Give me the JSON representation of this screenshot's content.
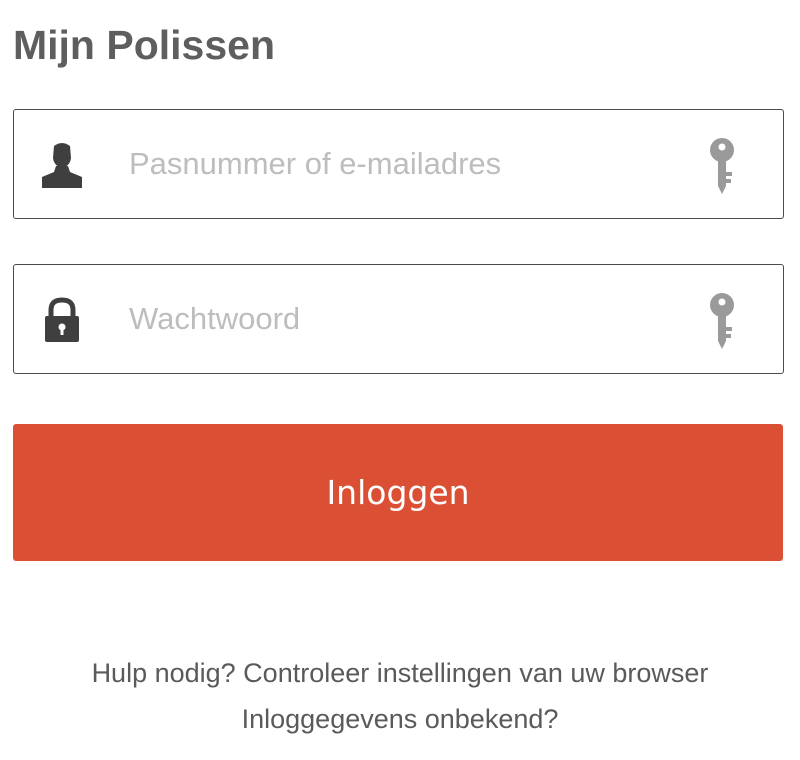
{
  "header": {
    "title": "Mijn Polissen"
  },
  "form": {
    "username": {
      "placeholder": "Pasnummer of e-mailadres",
      "value": "",
      "icon": "user-icon",
      "action_icon": "key-icon"
    },
    "password": {
      "placeholder": "Wachtwoord",
      "value": "",
      "icon": "lock-icon",
      "action_icon": "key-icon"
    },
    "submit_label": "Inloggen"
  },
  "links": {
    "help": "Hulp nodig? Controleer instellingen van uw browser",
    "forgot": "Inloggegevens onbekend?"
  },
  "colors": {
    "accent": "#db5035",
    "title": "#5e5e5e",
    "icon_dark": "#3f3f3f",
    "icon_light": "#9a9a9a",
    "placeholder": "#bdbdbd"
  }
}
